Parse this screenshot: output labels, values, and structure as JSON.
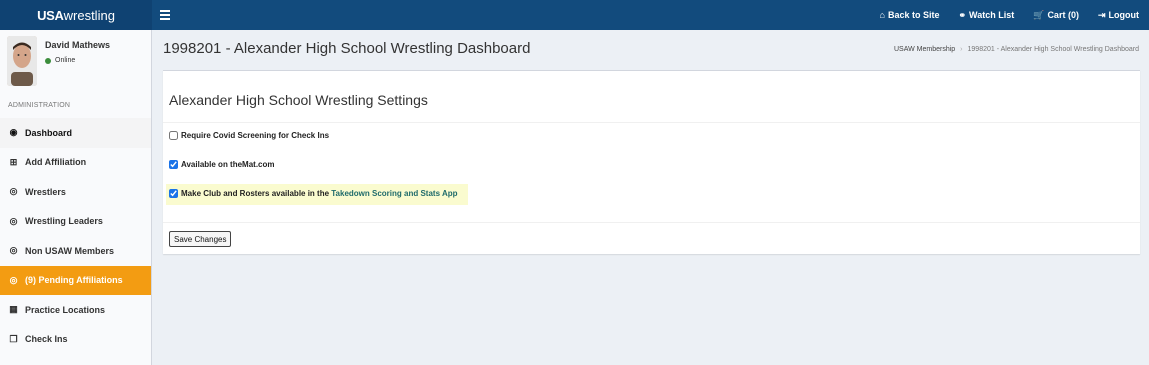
{
  "topbar": {
    "logo_bold": "USA",
    "logo_rest": "wrestling",
    "nav": [
      {
        "icon": "home-icon",
        "glyph": "⌂",
        "label": "Back to Site"
      },
      {
        "icon": "binoculars-icon",
        "glyph": "⚭",
        "label": "Watch List"
      },
      {
        "icon": "cart-icon",
        "glyph": "🛒",
        "label": "Cart (0)"
      },
      {
        "icon": "logout-icon",
        "glyph": "⇥",
        "label": "Logout"
      }
    ]
  },
  "user": {
    "name": "David Mathews",
    "status": "Online",
    "status_color": "#3c8d3c"
  },
  "sidebar": {
    "section_header": "ADMINISTRATION",
    "items": [
      {
        "label": "Dashboard",
        "icon": "dashboard-icon",
        "glyph": "◉"
      },
      {
        "label": "Add Affiliation",
        "icon": "plus-square-icon",
        "glyph": "⊞"
      },
      {
        "label": "Wrestlers",
        "icon": "user-circle-icon",
        "glyph": "◎"
      },
      {
        "label": "Wrestling Leaders",
        "icon": "user-circle-icon",
        "glyph": "◎"
      },
      {
        "label": "Non USAW Members",
        "icon": "user-circle-icon",
        "glyph": "◎"
      },
      {
        "label": "(9) Pending Affiliations",
        "icon": "user-circle-icon",
        "glyph": "◎"
      },
      {
        "label": "Practice Locations",
        "icon": "building-icon",
        "glyph": "▦"
      },
      {
        "label": "Check Ins",
        "icon": "copy-icon",
        "glyph": "❐"
      }
    ]
  },
  "page": {
    "title": "1998201 - Alexander High School Wrestling Dashboard",
    "breadcrumb": [
      "USAW Membership",
      "1998201 - Alexander High School Wrestling Dashboard"
    ]
  },
  "settings": {
    "title": "Alexander High School Wrestling Settings",
    "options": [
      {
        "label": "Require Covid Screening for Check Ins",
        "checked": false
      },
      {
        "label": "Available on theMat.com",
        "checked": true
      },
      {
        "label_prefix": "Make Club and Rosters available in the ",
        "link_text": "Takedown Scoring and Stats App",
        "checked": true
      }
    ],
    "save_label": "Save Changes"
  },
  "colors": {
    "topbar": "#124b7d",
    "pending": "#f39c12",
    "highlight": "#fafbcf"
  }
}
